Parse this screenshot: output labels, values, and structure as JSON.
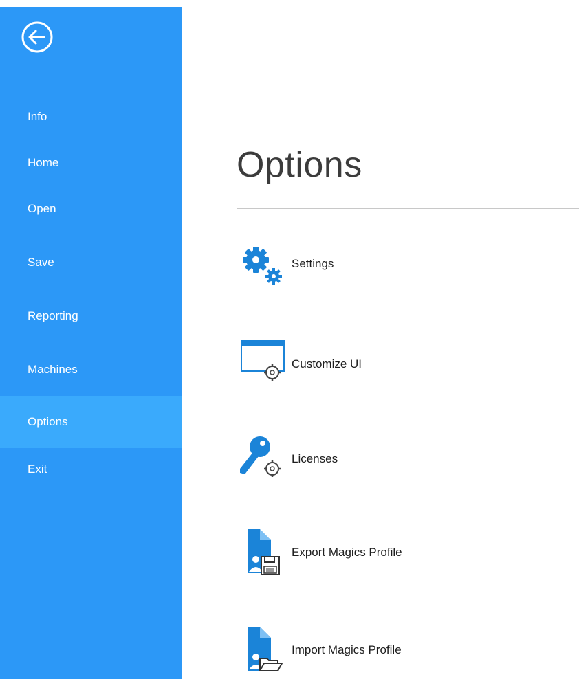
{
  "sidebar": {
    "back_label": "Back",
    "items": [
      {
        "label": "Info"
      },
      {
        "label": "Home"
      },
      {
        "label": "Open"
      },
      {
        "label": "Save"
      },
      {
        "label": "Reporting"
      },
      {
        "label": "Machines"
      },
      {
        "label": "Options",
        "active": true
      },
      {
        "label": "Exit"
      }
    ]
  },
  "main": {
    "title": "Options",
    "options": [
      {
        "label": "Settings",
        "icon": "gears-icon"
      },
      {
        "label": "Customize UI",
        "icon": "customize-ui-icon"
      },
      {
        "label": "Licenses",
        "icon": "key-icon"
      },
      {
        "label": "Export Magics Profile",
        "icon": "export-profile-icon"
      },
      {
        "label": "Import Magics Profile",
        "icon": "import-profile-icon"
      }
    ]
  },
  "colors": {
    "sidebar": "#2c98f7",
    "sidebar_active": "#3aaafc",
    "icon_blue": "#1b84d8"
  }
}
